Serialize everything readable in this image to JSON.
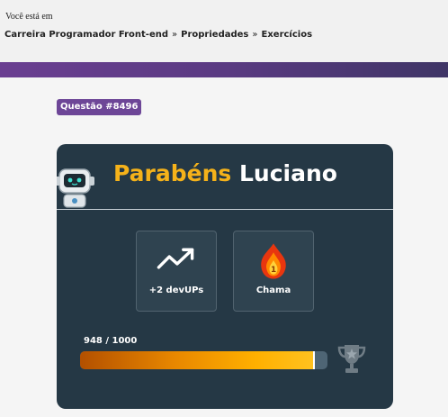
{
  "header": {
    "you_are_in": "Você está em",
    "breadcrumb": [
      "Carreira Programador Front-end",
      "Propriedades",
      "Exercícios"
    ],
    "breadcrumb_separator": "»"
  },
  "question": {
    "badge": "Questão #8496"
  },
  "card": {
    "congrats": "Parabéns",
    "user_name": "Luciano",
    "rewards": [
      {
        "label": "+2 devUPs",
        "icon": "trending-up-icon"
      },
      {
        "label": "Chama",
        "icon": "flame-icon",
        "count": "1"
      }
    ],
    "progress": {
      "label": "948 / 1000",
      "current": 948,
      "max": 1000
    },
    "trophy_icon": "trophy-icon"
  },
  "colors": {
    "purple": "#6d4697",
    "card_bg": "#253845",
    "accent_yellow": "#f5b21a",
    "progress_orange": "#ffb000"
  }
}
